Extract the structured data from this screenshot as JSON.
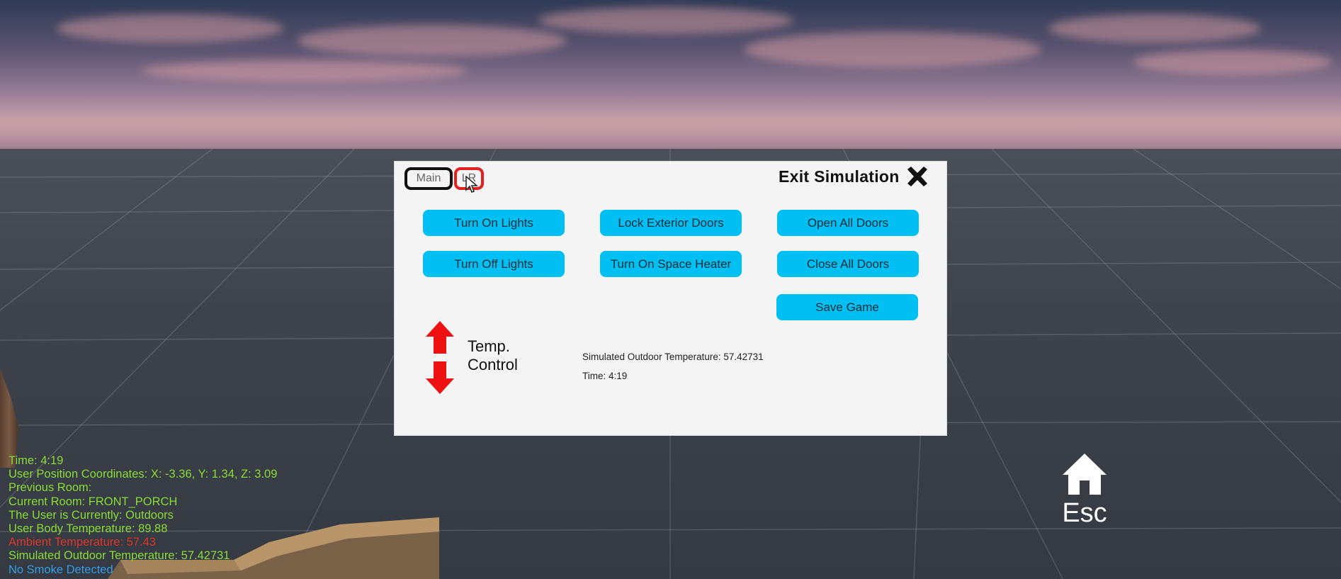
{
  "hud": {
    "time": "Time: 4:19",
    "position": "User Position Coordinates: X: -3.36, Y: 1.34, Z: 3.09",
    "previous_room": "Previous Room:",
    "current_room": "Current Room: FRONT_PORCH",
    "user_status": "The User is Currently: Outdoors",
    "body_temp": "User Body Temperature: 89.88",
    "ambient_temp": "Ambient Temperature: 57.43",
    "outdoor_temp": "Simulated Outdoor Temperature: 57.42731",
    "smoke": "No Smoke Detected"
  },
  "esc_label": "Esc",
  "panel": {
    "tabs": [
      {
        "label": "Main"
      },
      {
        "label": "LR"
      }
    ],
    "exit_label": "Exit Simulation",
    "buttons": {
      "turn_on_lights": "Turn On Lights",
      "lock_exterior_doors": "Lock Exterior Doors",
      "open_all_doors": "Open All Doors",
      "turn_off_lights": "Turn Off Lights",
      "turn_on_space_heater": "Turn On Space Heater",
      "close_all_doors": "Close All Doors",
      "save_game": "Save Game"
    },
    "temp_control_line1": "Temp.",
    "temp_control_line2": "Control",
    "outdoor_temp": "Simulated Outdoor Temperature: 57.42731",
    "time": "Time: 4:19"
  },
  "colors": {
    "button": "#00bff2",
    "hud_green": "#8ee03a",
    "hud_red": "#e23b2e",
    "hud_blue": "#3aa0e8",
    "arrow_red": "#ee1111",
    "tab_active_border": "#111111",
    "tab_selected_border": "#e12020"
  },
  "icons": {
    "close": "close-x-icon",
    "arrow_up": "arrow-up-icon",
    "arrow_down": "arrow-down-icon",
    "home": "home-icon",
    "cursor": "mouse-cursor-icon"
  }
}
